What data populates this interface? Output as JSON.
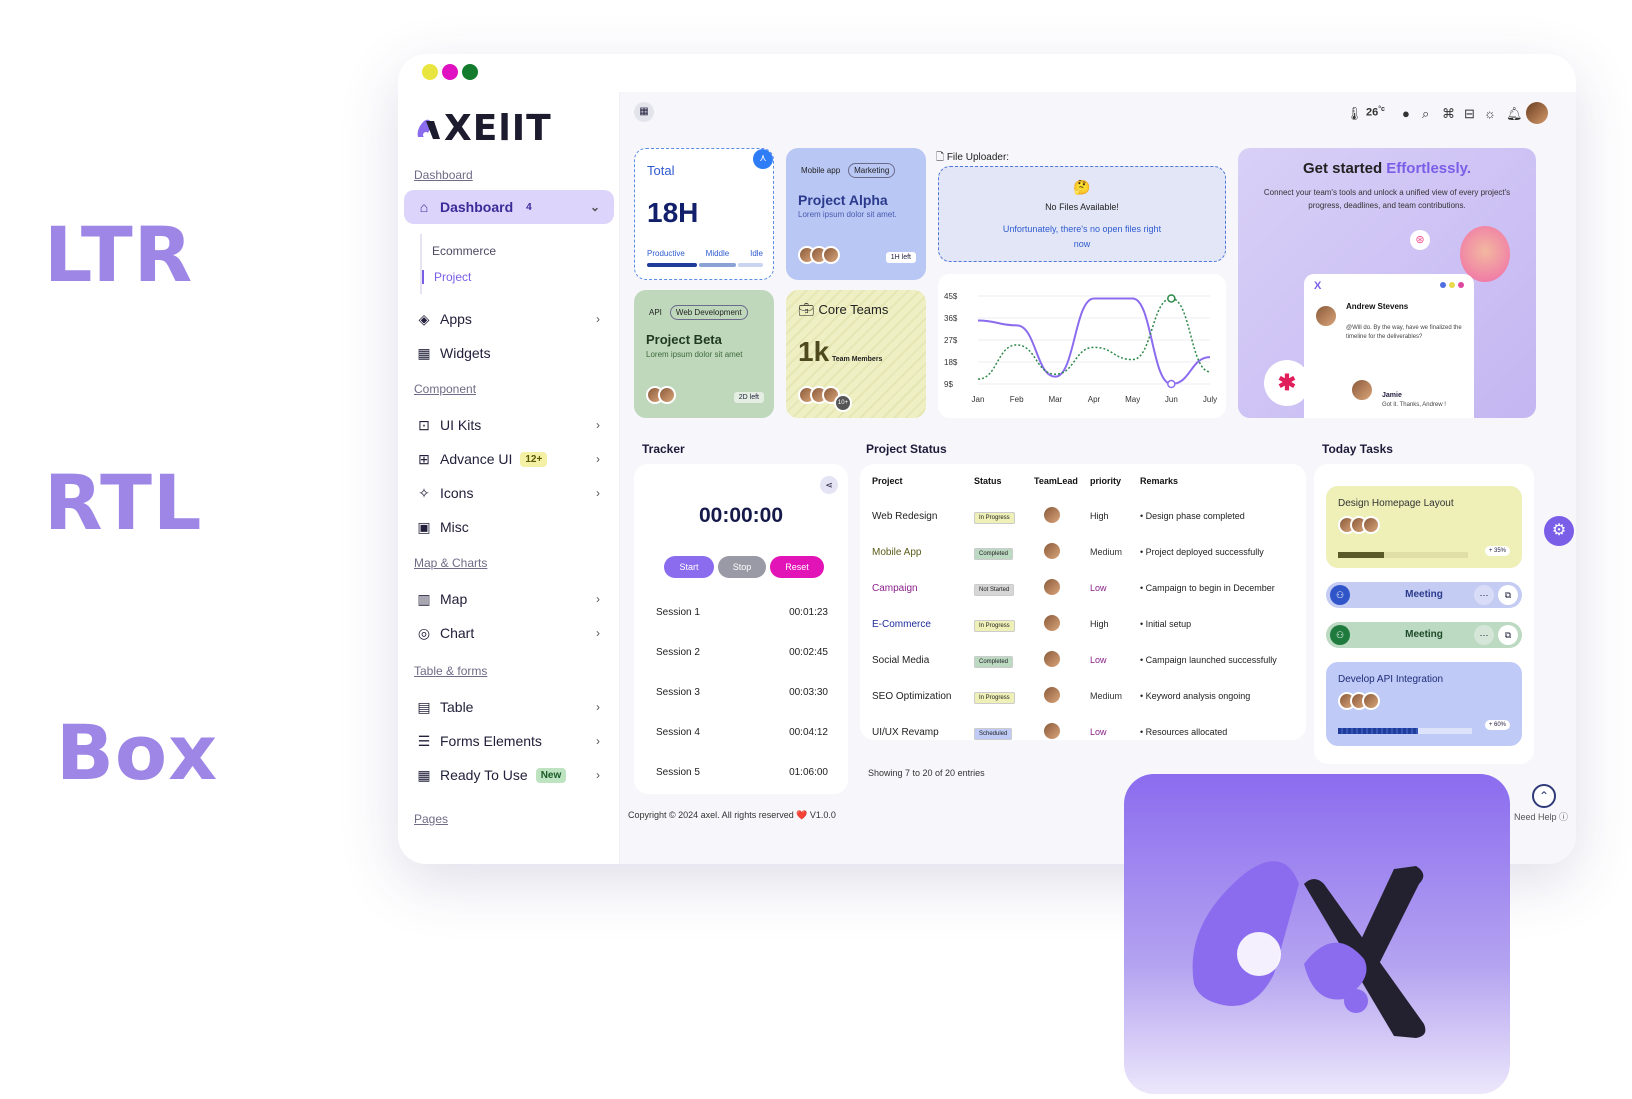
{
  "labels": {
    "ltr": "LTR",
    "rtl": "RTL",
    "box": "Box"
  },
  "brand": {
    "logo_text": "XElIT",
    "accent": "#8b6cef"
  },
  "sidebar": {
    "sections": {
      "dashboard": "Dashboard",
      "component": "Component",
      "map_charts": "Map & Charts",
      "table_forms": "Table & forms",
      "pages": "Pages"
    },
    "dashboard": {
      "label": "Dashboard",
      "badge": "4"
    },
    "dashboard_sub": [
      "Ecommerce",
      "Project"
    ],
    "apps": "Apps",
    "widgets": "Widgets",
    "ui_kits": "UI Kits",
    "advance_ui": {
      "label": "Advance UI",
      "badge": "12+"
    },
    "icons": "Icons",
    "misc": "Misc",
    "map": "Map",
    "chart": "Chart",
    "table": "Table",
    "forms": "Forms Elements",
    "ready": {
      "label": "Ready To Use",
      "badge": "New"
    }
  },
  "topbar": {
    "temp": "26",
    "temp_unit": "°c"
  },
  "total_card": {
    "title": "Total",
    "value": "18H",
    "legend": [
      "Productive",
      "Middle",
      "Idle"
    ]
  },
  "alpha_card": {
    "tags": [
      "Mobile app",
      "Marketing"
    ],
    "title": "Project Alpha",
    "desc": "Lorem ipsum dolor sit amet.",
    "time": "1H left"
  },
  "beta_card": {
    "tags": [
      "API",
      "Web Development"
    ],
    "title": "Project Beta",
    "desc": "Lorem ipsum dolor sit amet",
    "time": "2D left"
  },
  "core_card": {
    "title": "Core Teams",
    "value": "1k",
    "sub": "Team Members",
    "more": "10+"
  },
  "uploader": {
    "title": "File Uploader:",
    "emoji": "🤔",
    "empty": "No Files Available!",
    "msg": "Unfortunately, there's no open files right now"
  },
  "chart_data": {
    "type": "line",
    "categories": [
      "Jan",
      "Feb",
      "Mar",
      "Apr",
      "May",
      "Jun",
      "July"
    ],
    "y_ticks": [
      "9$",
      "18$",
      "27$",
      "36$",
      "45$"
    ],
    "ylim": [
      9,
      45
    ],
    "series": [
      {
        "values": [
          35,
          33,
          12,
          44,
          44,
          9,
          20
        ],
        "color": "#8b6cef"
      },
      {
        "values": [
          11,
          25,
          13,
          24,
          19,
          44,
          14
        ],
        "color": "#2f8a4a"
      }
    ]
  },
  "promo": {
    "title_a": "Get started ",
    "title_b": "Effortlessly.",
    "desc": "Connect your team's tools and unlock a unified view of every project's progress, deadlines, and team contributions.",
    "chat_name": "Andrew Stevens",
    "chat_msg": "@Will do. By the way, have we finalized the timeline for the deliverables?",
    "reply_name": "Jamie",
    "reply_msg": "Got it. Thanks, Andrew !"
  },
  "tracker": {
    "title": "Tracker",
    "time": "00:00:00",
    "start": "Start",
    "stop": "Stop",
    "reset": "Reset",
    "sessions": [
      {
        "name": "Session 1",
        "time": "00:01:23",
        "color": "#bfcaf6"
      },
      {
        "name": "Session 2",
        "time": "00:02:45",
        "color": "#d8d1f5"
      },
      {
        "name": "Session 3",
        "time": "00:03:30",
        "color": "#f7b7e1"
      },
      {
        "name": "Session 4",
        "time": "00:04:12",
        "color": "#f1efb8"
      },
      {
        "name": "Session 5",
        "time": "01:06:00",
        "color": "#bcd9c2"
      }
    ]
  },
  "project_status": {
    "title": "Project Status",
    "headers": [
      "Project",
      "Status",
      "TeamLead",
      "priority",
      "Remarks"
    ],
    "rows": [
      {
        "project": "Web Redesign",
        "status": "In Progress",
        "priority": "High",
        "remarks": "Design phase completed"
      },
      {
        "project": "Mobile App",
        "status": "Completed",
        "priority": "Medium",
        "remarks": "Project deployed successfully"
      },
      {
        "project": "Campaign",
        "status": "Not Started",
        "priority": "Low",
        "remarks": "Campaign to begin in December"
      },
      {
        "project": "E-Commerce",
        "status": "In Progress",
        "priority": "High",
        "remarks": "Initial setup"
      },
      {
        "project": "Social Media",
        "status": "Completed",
        "priority": "Low",
        "remarks": "Campaign launched successfully"
      },
      {
        "project": "SEO Optimization",
        "status": "In Progress",
        "priority": "Medium",
        "remarks": "Keyword analysis ongoing"
      },
      {
        "project": "UI/UX Revamp",
        "status": "Scheduled",
        "priority": "Low",
        "remarks": "Resources allocated"
      }
    ],
    "footer": "Showing 7 to 20 of 20 entries"
  },
  "tasks": {
    "title": "Today Tasks",
    "t1": {
      "title": "Design Homepage Layout",
      "pct": "+ 35%",
      "progress": 0.35
    },
    "m1": "Meeting",
    "m2": "Meeting",
    "t2": {
      "title": "Develop API Integration",
      "pct": "+ 60%",
      "progress": 0.6
    }
  },
  "footer": {
    "copyright": "Copyright © 2024 axel. All rights reserved ❤️ V1.0.0",
    "help": "Need Help ⓘ"
  }
}
